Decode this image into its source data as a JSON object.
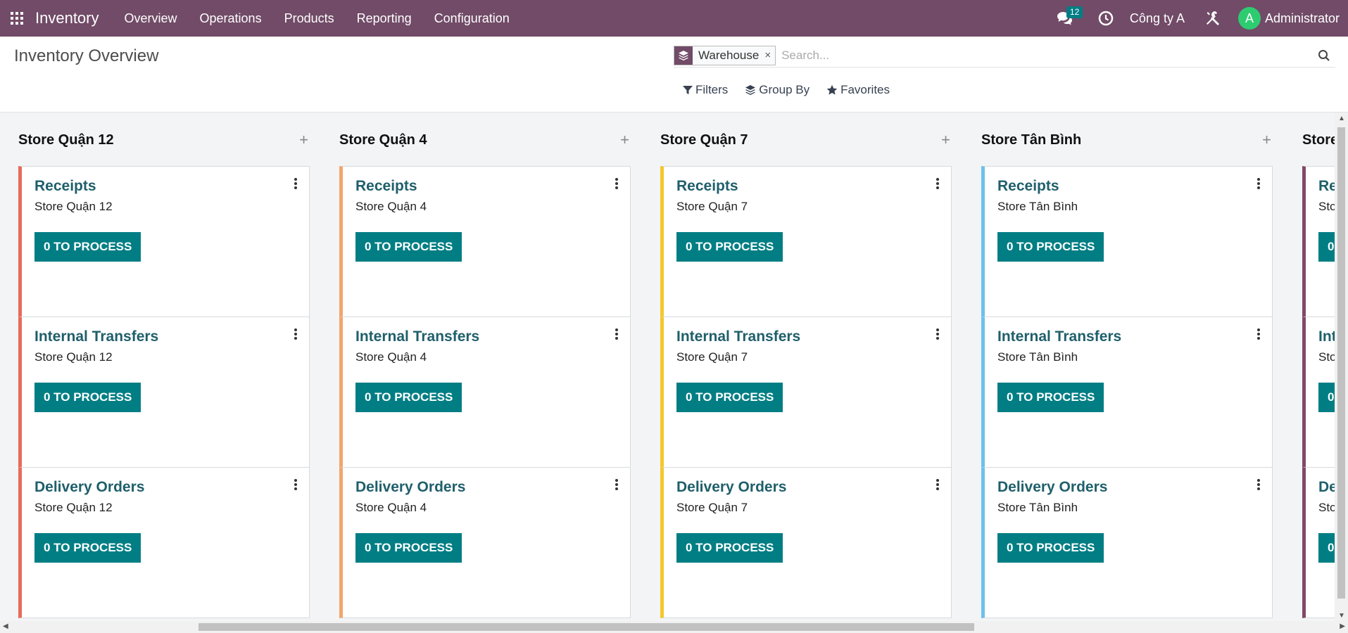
{
  "navbar": {
    "brand": "Inventory",
    "menu": [
      "Overview",
      "Operations",
      "Products",
      "Reporting",
      "Configuration"
    ],
    "messages_count": "12",
    "company": "Công ty A",
    "avatar_letter": "A",
    "user": "Administrator"
  },
  "control": {
    "title": "Inventory Overview",
    "facet_label": "Warehouse",
    "facet_remove": "×",
    "search_placeholder": "Search...",
    "filters_label": "Filters",
    "groupby_label": "Group By",
    "favorites_label": "Favorites"
  },
  "columns": [
    {
      "name": "Store Quận 12",
      "color": "#e86b5a",
      "cards": [
        {
          "title": "Receipts",
          "sub": "Store Quận 12",
          "button": "0 TO PROCESS"
        },
        {
          "title": "Internal Transfers",
          "sub": "Store Quận 12",
          "button": "0 TO PROCESS"
        },
        {
          "title": "Delivery Orders",
          "sub": "Store Quận 12",
          "button": "0 TO PROCESS"
        }
      ]
    },
    {
      "name": "Store Quận 4",
      "color": "#f2a56a",
      "cards": [
        {
          "title": "Receipts",
          "sub": "Store Quận 4",
          "button": "0 TO PROCESS"
        },
        {
          "title": "Internal Transfers",
          "sub": "Store Quận 4",
          "button": "0 TO PROCESS"
        },
        {
          "title": "Delivery Orders",
          "sub": "Store Quận 4",
          "button": "0 TO PROCESS"
        }
      ]
    },
    {
      "name": "Store Quận 7",
      "color": "#f4c72c",
      "cards": [
        {
          "title": "Receipts",
          "sub": "Store Quận 7",
          "button": "0 TO PROCESS"
        },
        {
          "title": "Internal Transfers",
          "sub": "Store Quận 7",
          "button": "0 TO PROCESS"
        },
        {
          "title": "Delivery Orders",
          "sub": "Store Quận 7",
          "button": "0 TO PROCESS"
        }
      ]
    },
    {
      "name": "Store Tân Bình",
      "color": "#6cc1ed",
      "cards": [
        {
          "title": "Receipts",
          "sub": "Store Tân Bình",
          "button": "0 TO PROCESS"
        },
        {
          "title": "Internal Transfers",
          "sub": "Store Tân Bình",
          "button": "0 TO PROCESS"
        },
        {
          "title": "Delivery Orders",
          "sub": "Store Tân Bình",
          "button": "0 TO PROCESS"
        }
      ]
    },
    {
      "name": "Store",
      "color": "#814968",
      "cards": [
        {
          "title": "Re",
          "sub": "Sto",
          "button": "0"
        },
        {
          "title": "Int",
          "sub": "Sto",
          "button": "0"
        },
        {
          "title": "De",
          "sub": "Sto",
          "button": "0"
        }
      ]
    }
  ],
  "icons": {
    "apps": "apps-grid-icon",
    "messages": "chat-icon",
    "activity": "clock-icon",
    "debug": "tools-icon",
    "search": "search-icon",
    "facet": "layers-icon",
    "filters": "filter-icon",
    "groupby": "layers-icon",
    "favorites": "star-icon"
  },
  "colors": {
    "navbar": "#714b67",
    "accent": "#017e84"
  }
}
